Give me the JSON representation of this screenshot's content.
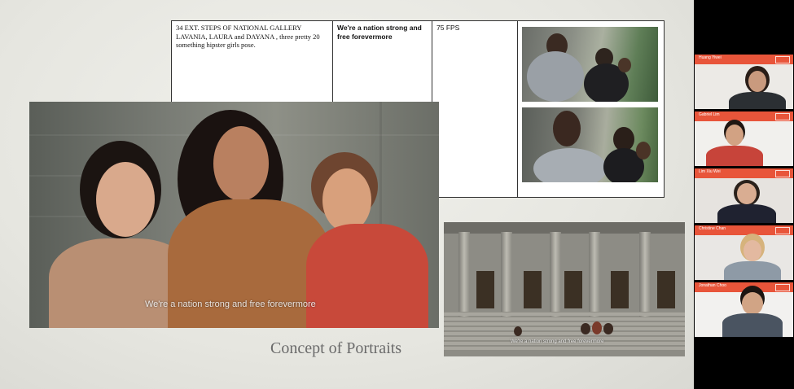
{
  "shot_table": {
    "scene": "34  EXT. STEPS OF NATIONAL GALLERY",
    "description": "LAVANIA, LAURA and DAYANA , three pretty 20 something hipster girls  pose.",
    "lyrics": "We're a nation strong and free forevermore",
    "frame_rate": "75 FPS"
  },
  "main_photo": {
    "subtitle": "We're a nation strong and free forevermore"
  },
  "building_photo": {
    "subtitle": "We're a nation strong and free forevermore"
  },
  "slide_caption": "Concept of Portraits",
  "participants": [
    {
      "name": "Huang Yiwei",
      "accent": "#e8553a"
    },
    {
      "name": "Gabriel Lim",
      "accent": "#e8553a"
    },
    {
      "name": "Lim Xiu Wei",
      "accent": "#e8553a"
    },
    {
      "name": "Christine Chan",
      "accent": "#e8553a"
    },
    {
      "name": "Jonathan Choo",
      "accent": "#e8553a"
    }
  ]
}
